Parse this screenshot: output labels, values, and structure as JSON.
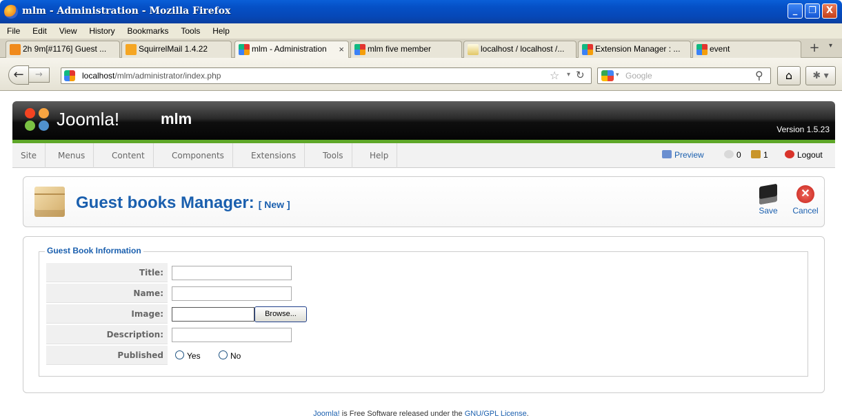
{
  "window": {
    "title": "mlm - Administration - Mozilla Firefox",
    "minimize": "_",
    "restore": "❐",
    "close": "X"
  },
  "menubar": [
    "File",
    "Edit",
    "View",
    "History",
    "Bookmarks",
    "Tools",
    "Help"
  ],
  "tabs": [
    {
      "label": "2h 9m[#1176] Guest ...",
      "icon": "clock-icon"
    },
    {
      "label": "SquirrelMail 1.4.22",
      "icon": "cpanel-icon"
    },
    {
      "label": "mlm - Administration",
      "icon": "joomla-icon",
      "active": true
    },
    {
      "label": "mlm five member",
      "icon": "joomla-icon"
    },
    {
      "label": "localhost / localhost /...",
      "icon": "phpmyadmin-icon"
    },
    {
      "label": "Extension Manager : ...",
      "icon": "joomla-icon"
    },
    {
      "label": "event",
      "icon": "joomla-icon"
    }
  ],
  "tab_close": "×",
  "new_tab": "+",
  "address": {
    "host": "localhost",
    "path": "/mlm/administrator/index.php"
  },
  "search": {
    "placeholder": "Google"
  },
  "joomla": {
    "brand": "Joomla!",
    "site_name": "mlm",
    "version": "Version 1.5.23",
    "menu": [
      "Site",
      "Menus",
      "Content",
      "Components",
      "Extensions",
      "Tools",
      "Help"
    ],
    "status": {
      "preview": "Preview",
      "messages": "0",
      "users": "1",
      "logout": "Logout"
    }
  },
  "toolbar": {
    "title": "Guest books Manager:",
    "subtitle": "[ New ]",
    "save": "Save",
    "cancel": "Cancel"
  },
  "form": {
    "legend": "Guest Book Information",
    "title_label": "Title:",
    "name_label": "Name:",
    "image_label": "Image:",
    "browse": "Browse...",
    "description_label": "Description:",
    "published_label": "Published",
    "yes": "Yes",
    "no": "No"
  },
  "footer": {
    "link1": "Joomla!",
    "text": " is Free Software released under the ",
    "link2": "GNU/GPL License",
    "end": "."
  },
  "colors": {
    "accent": "#1a5fae",
    "green_bar": "#5ea728",
    "header_dark": "#0e0e0e"
  }
}
